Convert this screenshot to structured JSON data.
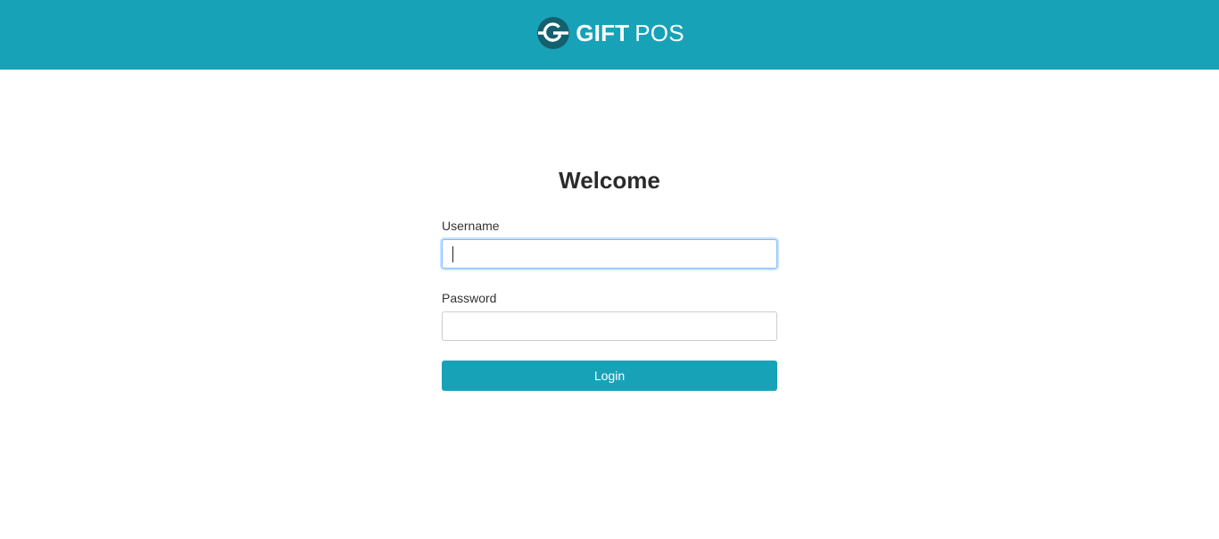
{
  "header": {
    "brand_bold": "GIFT",
    "brand_light": "POS",
    "logo_icon": "gift-pos-logo-icon",
    "background_color": "#18a2b8"
  },
  "login": {
    "title": "Welcome",
    "username_label": "Username",
    "username_value": "",
    "username_placeholder": "",
    "password_label": "Password",
    "password_value": "",
    "password_placeholder": "",
    "submit_label": "Login",
    "accent_color": "#18a2b8"
  }
}
